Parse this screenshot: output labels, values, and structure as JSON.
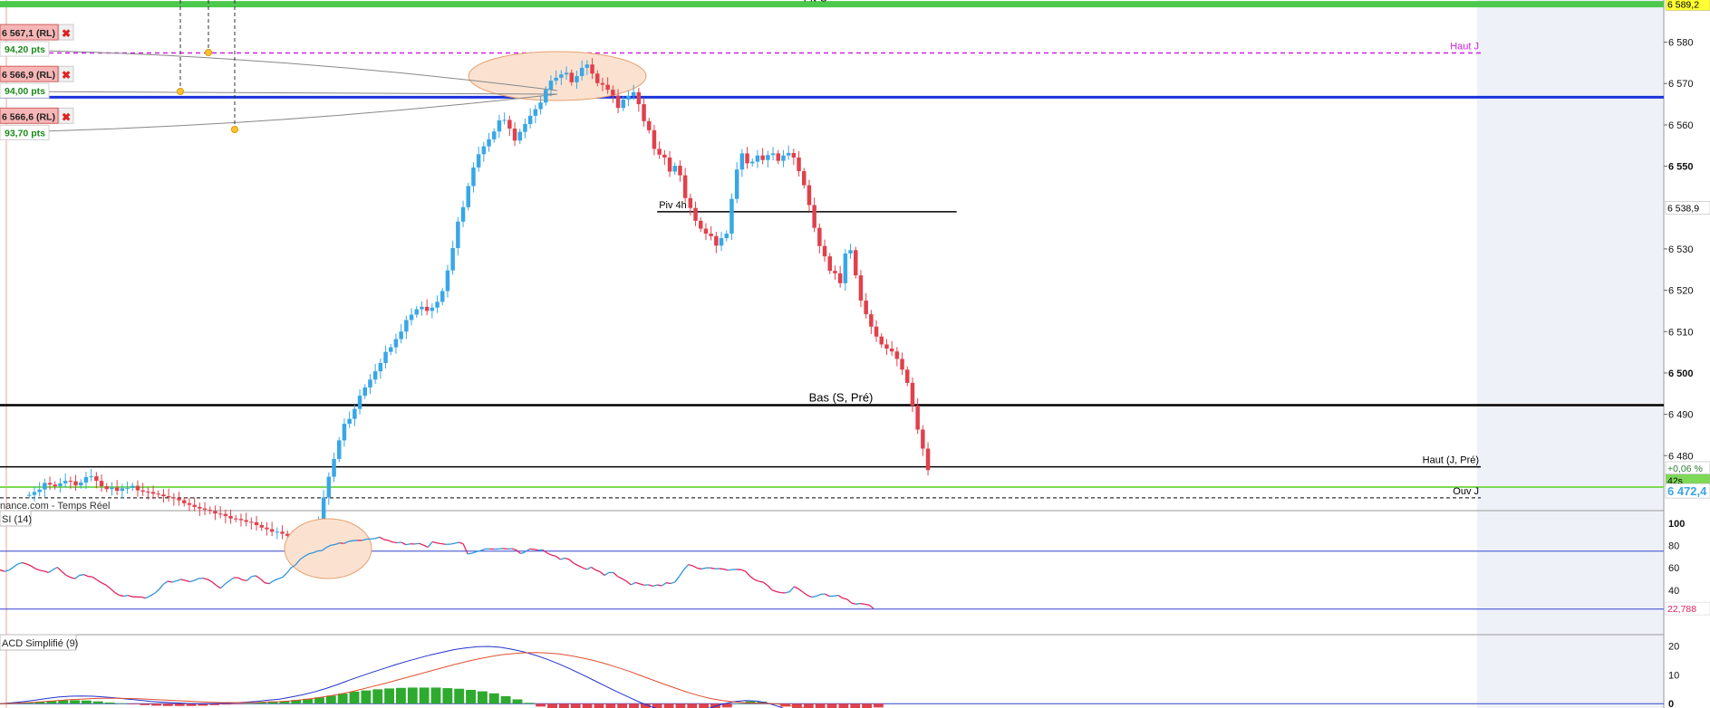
{
  "chart_data": [
    {
      "type": "candlestick",
      "title": "",
      "source_label": "nance.com - Temps Réel",
      "yaxis": {
        "ylim": [
          6466.7,
          6590.2
        ],
        "ticks": [
          {
            "value": 6580,
            "label": "6 580",
            "bold": false
          },
          {
            "value": 6570,
            "label": "6 570",
            "bold": false
          },
          {
            "value": 6560,
            "label": "6 560",
            "bold": false
          },
          {
            "value": 6550,
            "label": "6 550",
            "bold": true
          },
          {
            "value": 6530,
            "label": "6 530",
            "bold": false
          },
          {
            "value": 6520,
            "label": "6 520",
            "bold": false
          },
          {
            "value": 6510,
            "label": "6 510",
            "bold": false
          },
          {
            "value": 6500,
            "label": "6 500",
            "bold": true
          },
          {
            "value": 6490,
            "label": "6 490",
            "bold": false
          },
          {
            "value": 6480,
            "label": "6 480",
            "bold": false
          }
        ],
        "badges": [
          {
            "value": 6589.2,
            "label": "6 589,2",
            "bg": "#ffff33",
            "fg": "#000000"
          },
          {
            "value": 6540.0,
            "label": "6 538,9",
            "bg": "#ffffff",
            "fg": "#000000"
          },
          {
            "value": 6477.0,
            "label": "+0,06 %",
            "bg": "#ffffff",
            "fg": "#2e7d32"
          },
          {
            "value": 6474.0,
            "label": "42s",
            "bg": "#7ed957",
            "fg": "#000000"
          },
          {
            "value": 6471.5,
            "label": "6 472,4",
            "bg": "#ffffff",
            "fg": "#3aa6e0"
          }
        ]
      },
      "levels": [
        {
          "name": "Piv S",
          "value": 6589.2,
          "color": "#4cc94c",
          "style": "solid",
          "width": 7,
          "x_end": 1.0,
          "label": "Piv S",
          "label_pos": "top-center"
        },
        {
          "name": "Haut J",
          "value": 6577.4,
          "color": "#cc22dd",
          "style": "dashed",
          "width": 1.5,
          "x_end": 0.89,
          "label": "Haut J",
          "label_pos": "right"
        },
        {
          "name": "blue",
          "value": 6566.7,
          "color": "#1a33dd",
          "style": "solid",
          "width": 3,
          "x_end": 1.0,
          "label": "",
          "label_pos": "right"
        },
        {
          "name": "Piv 4h",
          "value": 6539.0,
          "color": "#000000",
          "style": "solid",
          "width": 1.5,
          "x_start": 0.395,
          "x_end": 0.575,
          "label": "Piv 4h",
          "label_pos": "left-above"
        },
        {
          "name": "Bas (S, Pré)",
          "value": 6492.2,
          "color": "#000000",
          "style": "solid",
          "width": 2.5,
          "x_end": 1.0,
          "label": "Bas (S, Pré)",
          "label_pos": "center-above"
        },
        {
          "name": "Haut (J, Pré)",
          "value": 6477.3,
          "color": "#000000",
          "style": "solid",
          "width": 1.5,
          "x_end": 0.89,
          "label": "Haut (J, Pré)",
          "label_pos": "right"
        },
        {
          "name": "green",
          "value": 6472.4,
          "color": "#7ed957",
          "style": "solid",
          "width": 2,
          "x_end": 1.0,
          "label": "",
          "label_pos": "right"
        },
        {
          "name": "Ouv J",
          "value": 6469.8,
          "color": "#000000",
          "style": "dashed",
          "width": 1,
          "x_end": 0.89,
          "label": "Ouv J",
          "label_pos": "right"
        }
      ],
      "orders": [
        {
          "price": "6 567,1 (RL)",
          "pts": "94,20 pts",
          "y_value": 6582.3
        },
        {
          "price": "6 566,9 (RL)",
          "pts": "94,00 pts",
          "y_value": 6572.2
        },
        {
          "price": "6 566,6 (RL)",
          "pts": "93,70 pts",
          "y_value": 6562.1
        }
      ],
      "candles_close": [
        6470.5,
        6471.2,
        6471.8,
        6473.4,
        6473.0,
        6472.6,
        6473.3,
        6473.9,
        6473.8,
        6472.8,
        6473.5,
        6474.8,
        6475.0,
        6473.9,
        6472.6,
        6471.9,
        6472.3,
        6471.5,
        6472.1,
        6472.2,
        6472.7,
        6471.6,
        6471.3,
        6471.2,
        6470.8,
        6470.6,
        6470.2,
        6469.9,
        6469.7,
        6469.2,
        6468.5,
        6468.1,
        6467.6,
        6467.2,
        6466.9,
        6466.6,
        6466.0,
        6465.9,
        6465.4,
        6464.8,
        6464.7,
        6464.4,
        6464.0,
        6463.9,
        6463.2,
        6462.6,
        6462.2,
        6461.6,
        6461.6,
        6461.1,
        6460.6,
        6459.7,
        6459.4,
        6458.8,
        6458.8,
        6458.2,
        6464.0,
        6469.9,
        6474.9,
        6479.2,
        6483.7,
        6487.7,
        6488.9,
        6491.3,
        6494.5,
        6496.5,
        6498.4,
        6500.4,
        6502.4,
        6505.1,
        6506.2,
        6508.2,
        6510.0,
        6512.8,
        6514.1,
        6515.4,
        6516.0,
        6515.0,
        6515.8,
        6517.2,
        6519.8,
        6524.8,
        6530.2,
        6536.6,
        6540.1,
        6545.2,
        6549.7,
        6552.9,
        6554.8,
        6556.5,
        6558.4,
        6561.1,
        6561.2,
        6559.1,
        6556.2,
        6558.3,
        6560.2,
        6562.2,
        6563.8,
        6565.4,
        6568.5,
        6570.7,
        6571.4,
        6572.2,
        6572.6,
        6570.3,
        6571.8,
        6573.8,
        6574.6,
        6572.4,
        6570.1,
        6569.7,
        6568.5,
        6567.1,
        6564.1,
        6566.1,
        6567.0,
        6567.9,
        6565.0,
        6560.9,
        6558.7,
        6554.2,
        6552.8,
        6552.1,
        6548.7,
        6550.1,
        6547.8,
        6542.3,
        6539.9,
        6536.8,
        6534.9,
        6533.7,
        6533.1,
        6530.8,
        6532.6,
        6533.7,
        6542.1,
        6549.2,
        6553.1,
        6550.7,
        6551.1,
        6552.6,
        6551.5,
        6552.7,
        6553.1,
        6551.3,
        6552.6,
        6553.2,
        6552.1,
        6548.8,
        6545.4,
        6540.6,
        6535.1,
        6530.7,
        6528.2,
        6524.7,
        6524.1,
        6521.7,
        6528.9,
        6529.7,
        6523.6,
        6517.5,
        6514.2,
        6511.2,
        6508.8,
        6506.9,
        6505.9,
        6505.2,
        6503.4,
        6500.8,
        6497.6,
        6492.1,
        6486.3,
        6481.7,
        6476.5
      ],
      "rsi": {
        "label": "SI (14)",
        "ylim": [
          0,
          100
        ],
        "ticks": [
          {
            "value": 100,
            "label": "100",
            "bold": true
          },
          {
            "value": 80,
            "label": "80",
            "bold": false
          },
          {
            "value": 60,
            "label": "60",
            "bold": false
          },
          {
            "value": 40,
            "label": "40",
            "bold": false
          }
        ],
        "upper": 75,
        "lower": 23,
        "last_label": "22,788",
        "values": [
          58.1,
          56.8,
          57.8,
          60.5,
          63.4,
          64.6,
          63.5,
          61.8,
          59.3,
          57.8,
          57.0,
          55.8,
          58.4,
          60.5,
          56.7,
          53.3,
          51.4,
          50.3,
          53.3,
          53.9,
          52.3,
          51.8,
          49.1,
          46.6,
          44.6,
          41.5,
          37.9,
          35.5,
          34.6,
          35.3,
          34.0,
          33.9,
          33.8,
          32.8,
          34.7,
          37.0,
          40.3,
          45.1,
          48.0,
          47.2,
          48.3,
          49.6,
          48.7,
          47.6,
          48.6,
          50.4,
          50.7,
          49.7,
          47.6,
          44.3,
          41.7,
          45.5,
          48.4,
          51.2,
          51.1,
          49.1,
          48.6,
          52.2,
          52.9,
          50.2,
          46.6,
          45.8,
          48.4,
          50.1,
          51.4,
          55.3,
          60.1,
          62.7,
          67.5,
          70.3,
          72.6,
          73.6,
          75.2,
          75.5,
          78.4,
          80.3,
          81.0,
          82.3,
          81.9,
          83.7,
          84.4,
          84.7,
          84.6,
          85.7,
          86.0,
          86.3,
          87.6,
          85.5,
          84.6,
          83.1,
          82.5,
          82.9,
          80.8,
          81.5,
          81.4,
          81.9,
          80.4,
          78.5,
          83.4,
          82.3,
          81.7,
          81.1,
          81.2,
          81.9,
          82.9,
          81.5,
          72.5,
          73.2,
          74.5,
          75.5,
          77.0,
          77.0,
          76.8,
          77.0,
          77.4,
          76.9,
          77.2,
          76.1,
          72.8,
          74.2,
          76.9,
          76.7,
          75.8,
          76.2,
          73.3,
          71.5,
          70.4,
          67.6,
          68.7,
          67.7,
          64.2,
          62.1,
          60.2,
          58.6,
          60.6,
          58.1,
          56.5,
          53.3,
          55.8,
          55.8,
          52.2,
          50.3,
          48.0,
          44.8,
          46.8,
          45.6,
          44.5,
          44.8,
          43.6,
          44.7,
          43.9,
          46.6,
          45.9,
          47.3,
          52.6,
          58.4,
          62.9,
          61.9,
          59.8,
          59.0,
          59.9,
          60.0,
          59.2,
          59.3,
          58.9,
          57.8,
          58.5,
          58.6,
          58.4,
          56.8,
          52.5,
          49.5,
          47.9,
          47.1,
          44.1,
          40.0,
          38.6,
          37.7,
          37.5,
          38.6,
          43.2,
          41.1,
          38.2,
          35.3,
          33.7,
          34.5,
          36.3,
          36.5,
          34.5,
          34.7,
          35.3,
          32.8,
          31.8,
          28.4,
          27.4,
          28.0,
          27.3,
          26.6,
          23.5
        ]
      },
      "macd": {
        "label": "ACD Simplifié (9)",
        "ylim": [
          -1.5,
          24
        ],
        "ticks": [
          {
            "value": 20,
            "label": "20",
            "bold": false
          },
          {
            "value": 10,
            "label": "10",
            "bold": false
          },
          {
            "value": 0,
            "label": "0",
            "bold": true
          }
        ],
        "macd_line": [
          0.0,
          0.3,
          0.7,
          1.2,
          1.8,
          2.3,
          2.6,
          2.7,
          2.6,
          2.3,
          2.0,
          1.6,
          1.2,
          0.8,
          0.5,
          0.3,
          0.1,
          0.0,
          0.0,
          0.1,
          0.3,
          0.5,
          0.8,
          1.2,
          1.6,
          2.3,
          3.1,
          4.1,
          5.3,
          6.7,
          8.2,
          9.6,
          11.0,
          12.3,
          13.6,
          14.8,
          15.9,
          17.0,
          17.9,
          18.8,
          19.4,
          19.8,
          19.9,
          19.6,
          18.9,
          18.0,
          16.8,
          15.4,
          13.8,
          12.0,
          10.1,
          8.1,
          6.1,
          4.1,
          2.2,
          0.4,
          -1.2,
          -2.4,
          -3.1,
          -3.1,
          -2.5,
          -1.4,
          -0.2,
          0.7,
          1.1,
          0.9,
          0.1,
          -1.2,
          -2.9,
          -4.5,
          -5.8,
          -6.5,
          -6.7,
          -6.7,
          -6.6,
          -6.8
        ],
        "signal_line": [
          0.0,
          0.1,
          0.3,
          0.5,
          0.8,
          1.1,
          1.4,
          1.6,
          1.8,
          1.9,
          1.9,
          1.8,
          1.7,
          1.5,
          1.3,
          1.1,
          0.9,
          0.7,
          0.5,
          0.4,
          0.4,
          0.4,
          0.4,
          0.6,
          0.7,
          1.0,
          1.4,
          1.9,
          2.5,
          3.2,
          4.0,
          5.0,
          6.0,
          7.0,
          8.1,
          9.2,
          10.3,
          11.4,
          12.5,
          13.6,
          14.6,
          15.5,
          16.3,
          17.0,
          17.4,
          17.7,
          17.8,
          17.6,
          17.3,
          16.7,
          15.9,
          15.0,
          13.9,
          12.6,
          11.3,
          9.8,
          8.3,
          6.8,
          5.4,
          4.0,
          2.8,
          1.8,
          1.1,
          0.6,
          0.3,
          0.2,
          0.1,
          -0.2,
          -0.8,
          -1.5,
          -2.4,
          -3.2,
          -4.0,
          -4.6,
          -5.1,
          -5.5
        ],
        "histogram": [
          0.0,
          0.2,
          0.4,
          0.7,
          1.0,
          1.2,
          1.2,
          1.1,
          0.8,
          0.4,
          0.1,
          -0.2,
          -0.5,
          -0.7,
          -0.8,
          -0.8,
          -0.8,
          -0.7,
          -0.5,
          -0.3,
          -0.1,
          0.1,
          0.4,
          0.6,
          0.9,
          1.3,
          1.7,
          2.2,
          2.8,
          3.5,
          4.2,
          4.6,
          5.0,
          5.3,
          5.5,
          5.6,
          5.6,
          5.6,
          5.4,
          5.2,
          4.8,
          4.3,
          3.6,
          2.6,
          1.5,
          0.3,
          -1.0,
          -2.2,
          -3.5,
          -4.7,
          -5.8,
          -6.9,
          -7.8,
          -8.5,
          -9.1,
          -9.4,
          -9.5,
          -9.2,
          -8.5,
          -7.1,
          -5.3,
          -3.2,
          -1.3,
          0.1,
          0.8,
          0.7,
          0.0,
          -1.0,
          -2.1,
          -3.0,
          -3.4,
          -3.3,
          -2.7,
          -2.1,
          -1.5,
          -1.3
        ]
      }
    }
  ]
}
